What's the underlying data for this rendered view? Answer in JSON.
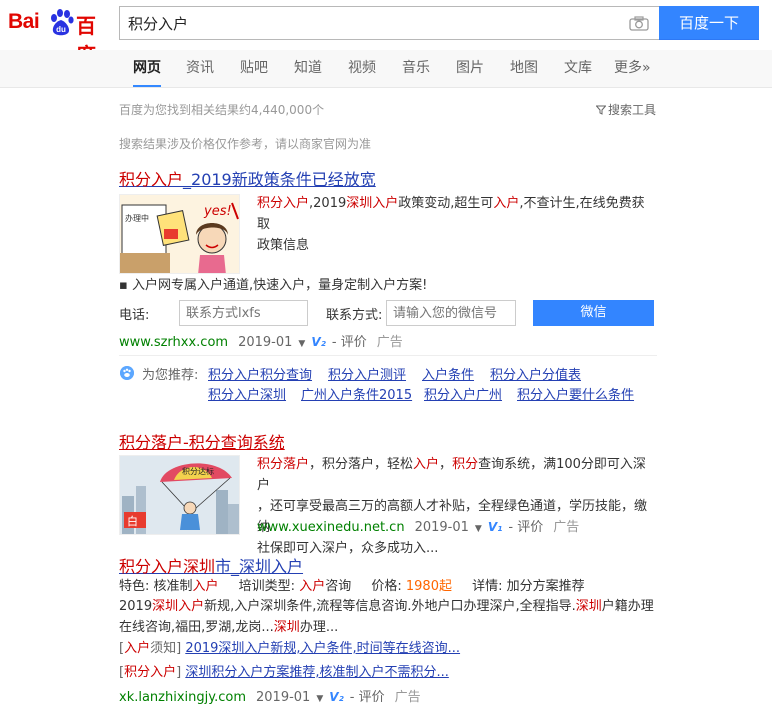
{
  "logo": {
    "text_left": "Bai",
    "text_right": "百度"
  },
  "search": {
    "query": "积分入户",
    "button_label": "百度一下"
  },
  "tabs": [
    "网页",
    "资讯",
    "贴吧",
    "知道",
    "视频",
    "音乐",
    "图片",
    "地图",
    "文库",
    "更多»"
  ],
  "meta": {
    "result_count": "百度为您找到相关结果约4,440,000个",
    "tools_label": "搜索工具",
    "notice": "搜索结果涉及价格仅作参考，请以商家官网为准"
  },
  "r1": {
    "title_hl": "积分入户",
    "title_rest": "_2019新政策条件已经放宽",
    "desc_hl1": "积分入户",
    "desc_t1": ",2019",
    "desc_hl2": "深圳入户",
    "desc_t2": "政策变动,超生可",
    "desc_hl3": "入户",
    "desc_t3": ",不查计生,在线免费获取",
    "desc_t4": "政策信息",
    "bullet": "▪ 入户网专属入户通道,快速入户，量身定制入户方案!",
    "phone_label": "电话:",
    "phone_placeholder": "联系方式lxfs",
    "contact_label": "联系方式:",
    "contact_placeholder": "请输入您的微信号",
    "wechat_button": "微信",
    "url": "www.szrhxx.com",
    "date": "2019-01",
    "v": "V₂",
    "rate": "评价",
    "ad": "广告",
    "thumb_text": "yes!"
  },
  "recommend": {
    "label": "为您推荐:",
    "links": [
      "积分入户积分查询",
      "积分入户测评",
      "入户条件",
      "积分入户分值表",
      "积分入户深圳",
      "广州入户条件2015",
      "积分入户广州",
      "积分入户要什么条件"
    ]
  },
  "r2": {
    "title": "积分落户-积分查询系统",
    "desc_hl1": "积分落户",
    "desc_t1": "，积分落户，轻松",
    "desc_hl2": "入户",
    "desc_t2": "，",
    "desc_hl3": "积分",
    "desc_t3": "查询系统，满100分即可入深户",
    "desc_t4": "，还可享受最高三万的高额人才补贴，全程绿色通道，学历技能，缴纳",
    "desc_t5": "社保即可入深户，众多成功入...",
    "url": "www.xuexinedu.net.cn",
    "date": "2019-01",
    "v": "V₁",
    "rate": "评价",
    "ad": "广告",
    "thumb_text": "积分达标"
  },
  "r3": {
    "title_hl": "积分入户深圳",
    "title_rest": "市_深圳入户",
    "f1_label": "特色: 核准制",
    "f1_hl": "入户",
    "f2_label": "培训类型: ",
    "f2_hl": "入户",
    "f2_rest": "咨询",
    "f3_label": "价格: ",
    "f3_val": "1980起",
    "f4": "详情: 加分方案推荐",
    "d1a": "2019",
    "d1b": "深圳入户",
    "d1c": "新规,入户深圳条件,流程等信息咨询.外地户口办理深户,全程指导.",
    "d1d": "深圳",
    "d1e": "户籍办理",
    "d2a": "在线咨询,福田,罗湖,龙岗...",
    "d2b": "深圳",
    "d2c": "办理...",
    "s1_prefix_hl": "入户",
    "s1_prefix": "须知]",
    "s1_link": "2019深圳入户新规,入户条件,时间等在线咨询...",
    "s2_prefix_hl": "积分入户",
    "s2_link": "深圳积分入户方案推荐,核准制入户不需积分...",
    "url": "xk.lanzhixingjy.com",
    "date": "2019-01",
    "v": "V₂",
    "rate": "评价",
    "ad": "广告"
  }
}
